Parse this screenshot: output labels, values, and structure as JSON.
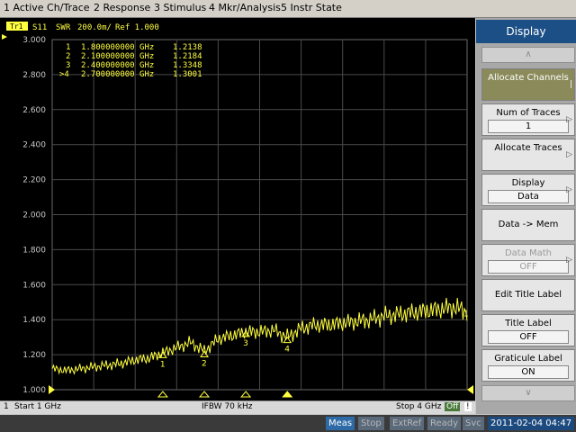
{
  "menu": [
    "1 Active Ch/Trace",
    "2 Response",
    "3 Stimulus",
    "4 Mkr/Analysis",
    "5 Instr State"
  ],
  "trace_header": {
    "trace_tag": "Tr1",
    "param": "S11",
    "format": "SWR",
    "scale": "200.0m/",
    "ref": "Ref 1.000"
  },
  "markers": [
    {
      "label": "1",
      "freq": "1.800000000 GHz",
      "value": "1.2138"
    },
    {
      "label": "2",
      "freq": "2.100000000 GHz",
      "value": "1.2184"
    },
    {
      "label": "3",
      "freq": "2.400000000 GHz",
      "value": "1.3348"
    },
    {
      "label": ">4",
      "freq": "2.700000000 GHz",
      "value": "1.3001"
    }
  ],
  "y_ticks": [
    "3.000",
    "2.800",
    "2.600",
    "2.400",
    "2.200",
    "2.000",
    "1.800",
    "1.600",
    "1.400",
    "1.200",
    "1.000"
  ],
  "channel_status": {
    "chan": "1",
    "start": "Start 1 GHz",
    "ifbw": "IFBW 70 kHz",
    "stop": "Stop 4 GHz",
    "off_badge": "Off",
    "bang": "!"
  },
  "softkeys": {
    "title": "Display",
    "allocate_channels": "Allocate Channels",
    "num_traces_label": "Num of Traces",
    "num_traces_value": "1",
    "allocate_traces": "Allocate Traces",
    "display_label": "Display",
    "display_value": "Data",
    "data_to_mem": "Data -> Mem",
    "data_math_label": "Data Math",
    "data_math_value": "OFF",
    "edit_title_label": "Edit Title Label",
    "title_label_label": "Title Label",
    "title_label_value": "OFF",
    "graticule_label_label": "Graticule Label",
    "graticule_label_value": "ON"
  },
  "status_bar": {
    "meas": "Meas",
    "stop": "Stop",
    "extref": "ExtRef",
    "ready": "Ready",
    "svc": "Svc",
    "datetime": "2011-02-04 04:47"
  },
  "colors": {
    "trace": "#ffff40",
    "grid": "#4a4a4a",
    "axis_text": "#c8c8c8",
    "title_bar": "#1c4f86"
  },
  "chart_data": {
    "type": "line",
    "xlabel": "",
    "ylabel": "",
    "xlim": [
      1,
      4
    ],
    "ylim": [
      1.0,
      3.0
    ],
    "marker_points": [
      {
        "label": "1",
        "x": 1.8,
        "y": 1.2138
      },
      {
        "label": "2",
        "x": 2.1,
        "y": 1.2184
      },
      {
        "label": "3",
        "x": 2.4,
        "y": 1.3348
      },
      {
        "label": "4",
        "x": 2.7,
        "y": 1.3001
      }
    ],
    "series": [
      {
        "x": [
          1.0,
          1.1,
          1.2,
          1.3,
          1.4,
          1.5,
          1.6,
          1.7,
          1.8,
          1.9,
          2.0,
          2.1,
          2.2,
          2.3,
          2.4,
          2.5,
          2.6,
          2.7,
          2.8,
          2.9,
          3.0,
          3.1,
          3.2,
          3.3,
          3.4,
          3.5,
          3.6,
          3.7,
          3.8,
          3.9,
          4.0
        ],
        "y": [
          1.12,
          1.11,
          1.12,
          1.13,
          1.14,
          1.15,
          1.17,
          1.18,
          1.21,
          1.24,
          1.27,
          1.22,
          1.29,
          1.31,
          1.33,
          1.33,
          1.34,
          1.3,
          1.35,
          1.37,
          1.37,
          1.38,
          1.39,
          1.4,
          1.42,
          1.43,
          1.44,
          1.45,
          1.46,
          1.47,
          1.45
        ],
        "ripple": 0.05
      }
    ]
  }
}
